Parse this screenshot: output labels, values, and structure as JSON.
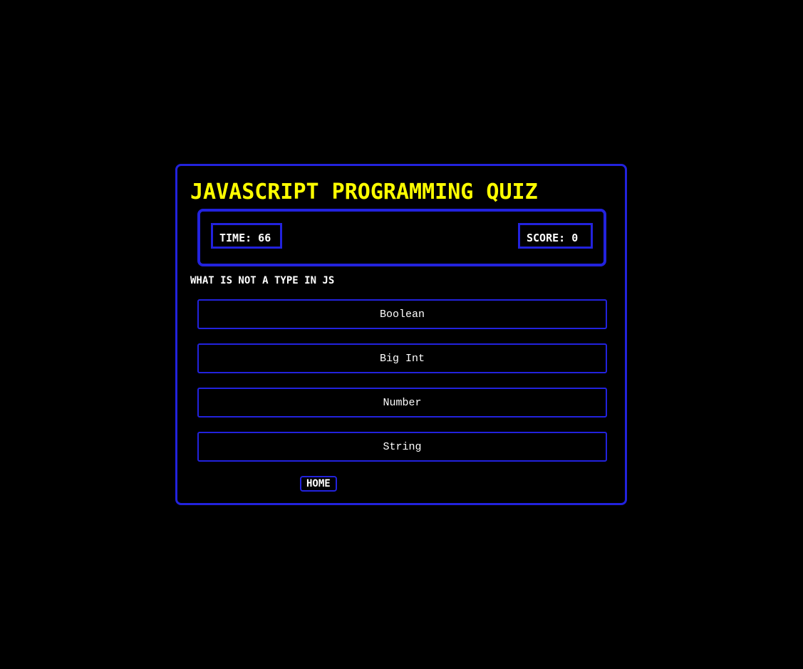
{
  "quiz": {
    "title": "JAVASCRIPT PROGRAMMING QUIZ",
    "time_label": "TIME: 66",
    "score_label": "SCORE: 0",
    "question": "WHAT IS NOT A TYPE IN JS",
    "answers": [
      {
        "label": "Boolean"
      },
      {
        "label": "Big Int"
      },
      {
        "label": "Number"
      },
      {
        "label": "String"
      }
    ],
    "home_label": "HOME"
  },
  "colors": {
    "background": "#000000",
    "border": "#2222dd",
    "title": "#ffff00",
    "text": "#ffffff"
  }
}
